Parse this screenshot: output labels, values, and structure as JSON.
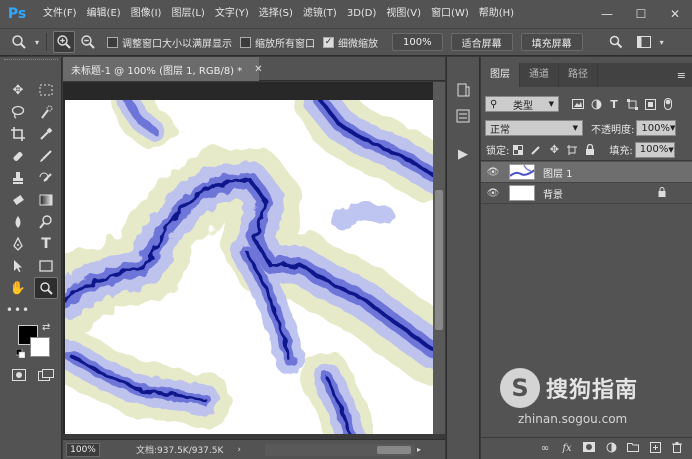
{
  "app": {
    "logo": "Ps"
  },
  "menu": [
    "文件(F)",
    "编辑(E)",
    "图像(I)",
    "图层(L)",
    "文字(Y)",
    "选择(S)",
    "滤镜(T)",
    "3D(D)",
    "视图(V)",
    "窗口(W)",
    "帮助(H)"
  ],
  "window_controls": {
    "minimize": "—",
    "maximize": "☐",
    "close": "✕"
  },
  "options": {
    "resize_windows_label": "调整窗口大小以满屏显示",
    "resize_windows_checked": false,
    "zoom_all_label": "缩放所有窗口",
    "zoom_all_checked": false,
    "scrubby_zoom_label": "细微缩放",
    "scrubby_zoom_checked": true,
    "zoom_100_label": "100%",
    "fit_screen_label": "适合屏幕",
    "fill_screen_label": "填充屏幕"
  },
  "document": {
    "tab_title": "未标题-1 @ 100% (图层 1, RGB/8) *",
    "zoom": "100%",
    "doc_info": "文档:937.5K/937.5K"
  },
  "layers_panel": {
    "tabs": [
      "图层",
      "通道",
      "路径"
    ],
    "active_tab": "图层",
    "filter_kind": "类型",
    "blend_mode": "正常",
    "opacity_label": "不透明度:",
    "opacity_value": "100%",
    "lock_label": "锁定:",
    "fill_label": "填充:",
    "fill_value": "100%",
    "layers": [
      {
        "name": "图层 1",
        "selected": true,
        "visible": true,
        "locked": false
      },
      {
        "name": "背景",
        "selected": false,
        "visible": true,
        "locked": true
      }
    ]
  },
  "watermark": {
    "name": "搜狗指南",
    "url": "zhinan.sogou.com"
  },
  "colors": {
    "foreground": "#000000",
    "background": "#ffffff",
    "ui_dark": "#535353",
    "accent": "#31a8ff"
  }
}
